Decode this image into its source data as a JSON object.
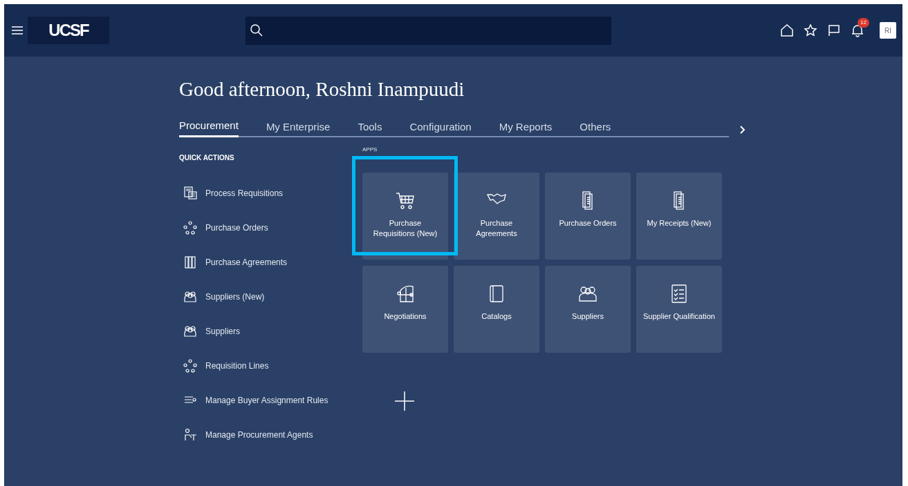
{
  "header": {
    "logo": "UCSF",
    "notifications": {
      "count": "12"
    },
    "avatar": "RI"
  },
  "greeting": "Good afternoon, Roshni Inampuudi",
  "tabs": [
    {
      "label": "Procurement",
      "selected": true
    },
    {
      "label": "My Enterprise",
      "selected": false
    },
    {
      "label": "Tools",
      "selected": false
    },
    {
      "label": "Configuration",
      "selected": false
    },
    {
      "label": "My Reports",
      "selected": false
    },
    {
      "label": "Others",
      "selected": false
    }
  ],
  "quick_actions": {
    "title": "QUICK ACTIONS",
    "items": [
      {
        "label": "Process Requisitions"
      },
      {
        "label": "Purchase Orders"
      },
      {
        "label": "Purchase Agreements"
      },
      {
        "label": "Suppliers (New)"
      },
      {
        "label": "Suppliers"
      },
      {
        "label": "Requisition Lines"
      },
      {
        "label": "Manage Buyer Assignment Rules"
      },
      {
        "label": "Manage Procurement Agents"
      }
    ]
  },
  "apps": {
    "title": "APPS",
    "tiles": [
      {
        "label": "Purchase Requisitions (New)",
        "highlighted": true
      },
      {
        "label": "Purchase Agreements",
        "highlighted": false
      },
      {
        "label": "Purchase Orders",
        "highlighted": false
      },
      {
        "label": "My Receipts (New)",
        "highlighted": false
      },
      {
        "label": "Negotiations",
        "highlighted": false
      },
      {
        "label": "Catalogs",
        "highlighted": false
      },
      {
        "label": "Suppliers",
        "highlighted": false
      },
      {
        "label": "Supplier Qualification",
        "highlighted": false
      }
    ]
  }
}
